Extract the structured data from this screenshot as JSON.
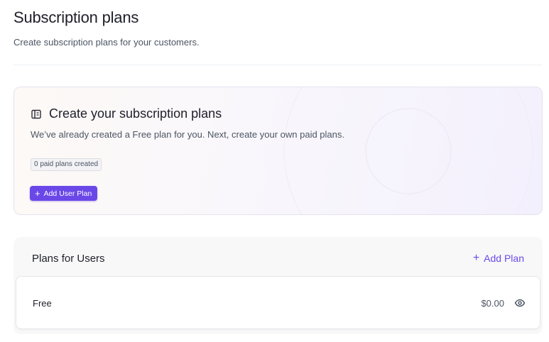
{
  "header": {
    "title": "Subscription plans",
    "subtitle": "Create subscription plans for your customers."
  },
  "hero": {
    "icon": "book-icon",
    "title": "Create your subscription plans",
    "description": "We’ve already created a Free plan for you. Next, create your own paid plans.",
    "badge": "0 paid plans created",
    "button_label": "Add User Plan",
    "button_icon": "plus-icon"
  },
  "plans_section": {
    "title": "Plans for Users",
    "add_label": "Add Plan",
    "plans": [
      {
        "name": "Free",
        "price": "$0.00",
        "action_icon": "eye-icon"
      }
    ]
  },
  "colors": {
    "accent": "#6a48e8",
    "text": "#1f1f2a",
    "muted": "#4b5563"
  }
}
